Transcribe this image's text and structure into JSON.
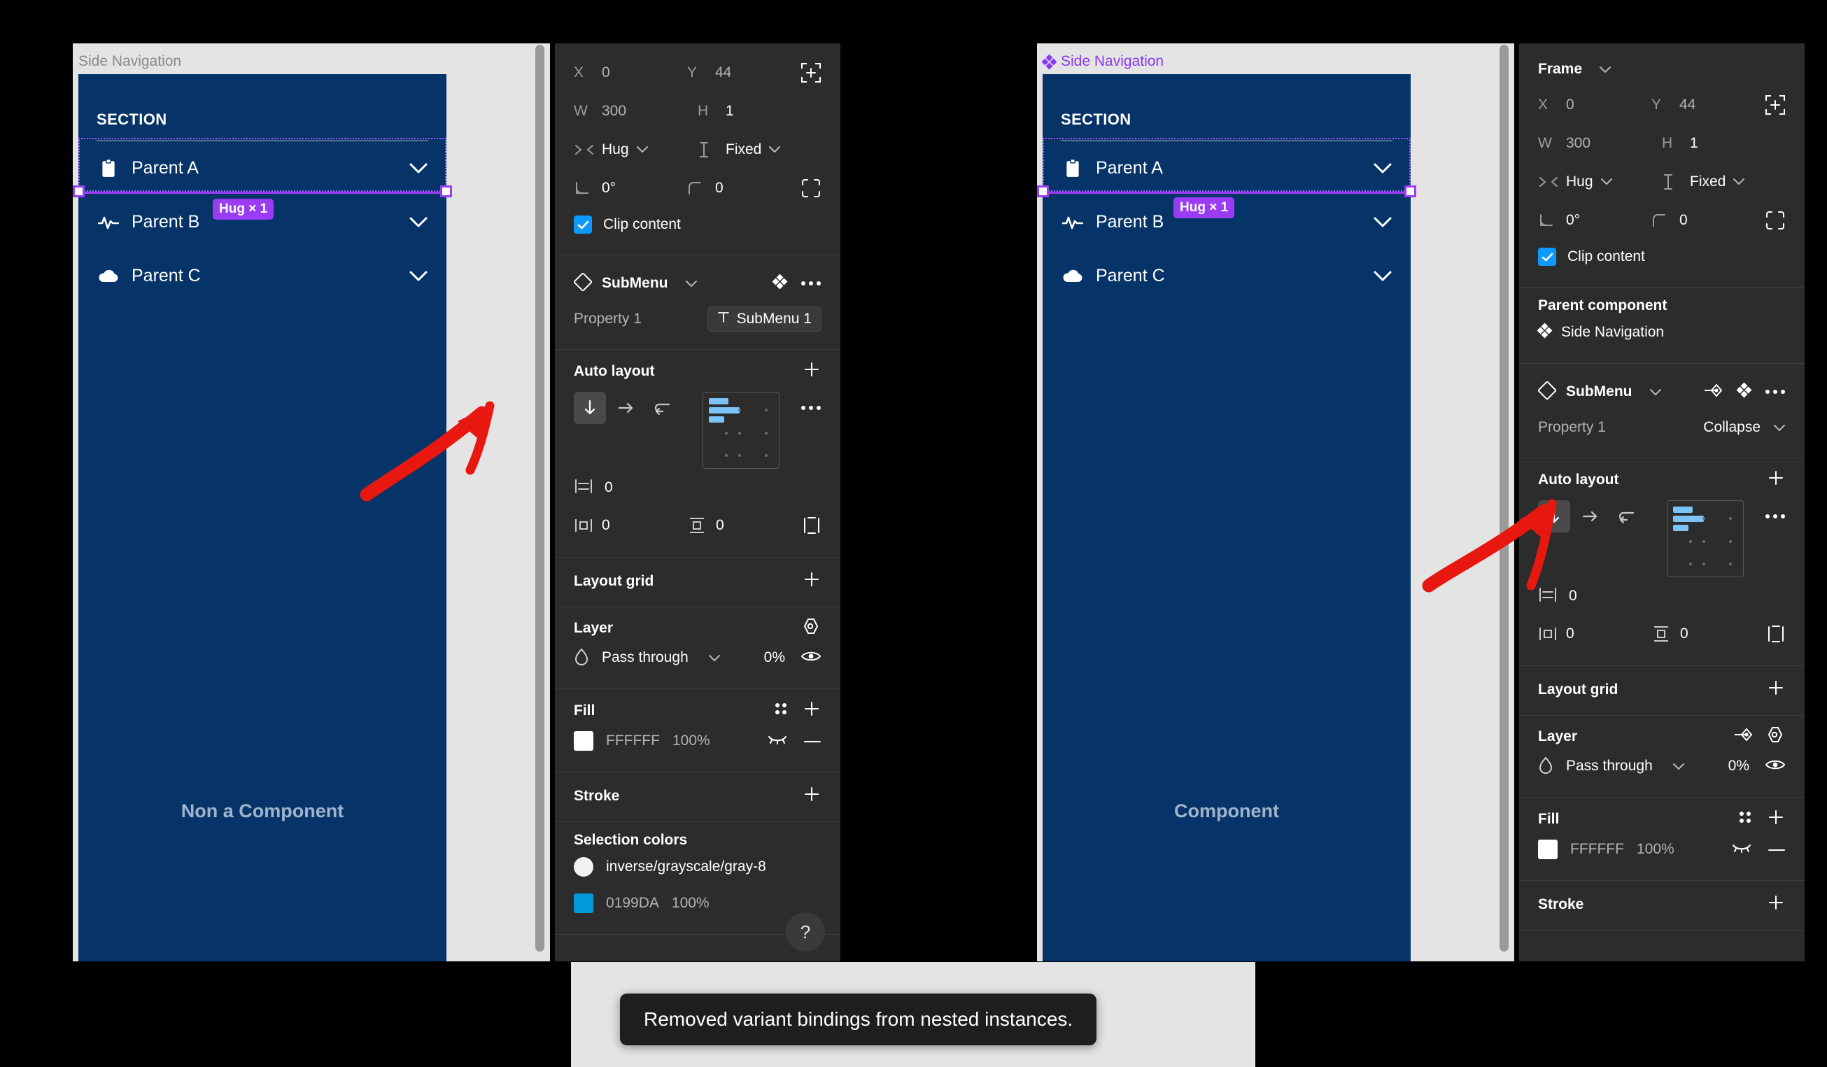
{
  "left": {
    "canvas": {
      "frame_label": "Side Navigation",
      "is_component": false,
      "section_header": "SECTION",
      "nav_items": [
        {
          "label": "Parent A",
          "icon": "clipboard-icon"
        },
        {
          "label": "Parent B",
          "icon": "activity-pulse-icon"
        },
        {
          "label": "Parent C",
          "icon": "cloud-icon"
        }
      ],
      "hug_badge": "Hug × 1",
      "center_note": "Non a Component"
    },
    "props": {
      "x_key": "X",
      "x_val": "0",
      "y_key": "Y",
      "y_val": "44",
      "w_key": "W",
      "w_val": "300",
      "h_key": "H",
      "h_val": "1",
      "horizontal_resizing": "Hug",
      "vertical_resizing": "Fixed",
      "rotation": "0°",
      "corner_radius": "0",
      "clip_content": "Clip content",
      "instance_name": "SubMenu",
      "property_key": "Property 1",
      "property_value": "SubMenu 1",
      "autolayout_title": "Auto layout",
      "gap": "0",
      "padding_h": "0",
      "padding_v": "0",
      "layout_grid_title": "Layout grid",
      "layer_title": "Layer",
      "blend_mode": "Pass through",
      "opacity": "0%",
      "fill_title": "Fill",
      "fill_hex": "FFFFFF",
      "fill_opacity": "100%",
      "stroke_title": "Stroke",
      "selection_colors_title": "Selection colors",
      "selection_colors": [
        {
          "name": "inverse/grayscale/gray-8",
          "swatch": "#f2f2f2",
          "shape": "circle",
          "opacity": ""
        },
        {
          "name": "0199DA",
          "swatch": "#0199da",
          "shape": "square",
          "opacity": "100%"
        }
      ],
      "help_label": "?"
    }
  },
  "right": {
    "canvas": {
      "frame_label": "Side Navigation",
      "is_component": true,
      "section_header": "SECTION",
      "nav_items": [
        {
          "label": "Parent A",
          "icon": "clipboard-icon"
        },
        {
          "label": "Parent B",
          "icon": "activity-pulse-icon"
        },
        {
          "label": "Parent C",
          "icon": "cloud-icon"
        }
      ],
      "hug_badge": "Hug × 1",
      "center_note": "Component"
    },
    "props": {
      "node_type": "Frame",
      "x_key": "X",
      "x_val": "0",
      "y_key": "Y",
      "y_val": "44",
      "w_key": "W",
      "w_val": "300",
      "h_key": "H",
      "h_val": "1",
      "horizontal_resizing": "Hug",
      "vertical_resizing": "Fixed",
      "rotation": "0°",
      "corner_radius": "0",
      "clip_content": "Clip content",
      "parent_component_title": "Parent component",
      "parent_component_name": "Side Navigation",
      "instance_name": "SubMenu",
      "property_key": "Property 1",
      "property_value": "Collapse",
      "autolayout_title": "Auto layout",
      "gap": "0",
      "padding_h": "0",
      "padding_v": "0",
      "layout_grid_title": "Layout grid",
      "layer_title": "Layer",
      "blend_mode": "Pass through",
      "opacity": "0%",
      "fill_title": "Fill",
      "fill_hex": "FFFFFF",
      "fill_opacity": "100%",
      "stroke_title": "Stroke"
    }
  },
  "toast": {
    "message": "Removed variant bindings from nested instances."
  },
  "colors": {
    "navy": "#063468",
    "selection_purple": "#9b3cf5",
    "accent_blue": "#0d99ff",
    "annotation_red": "#e8170f",
    "panel_dark": "#2c2c2c",
    "canvas_gray": "#e4e4e4"
  }
}
